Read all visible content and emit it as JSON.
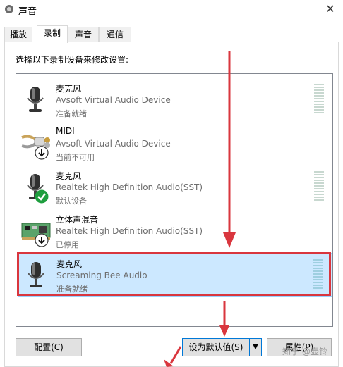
{
  "window": {
    "title": "声音",
    "close_glyph": "✕"
  },
  "tabs": [
    {
      "label": "播放",
      "active": false
    },
    {
      "label": "录制",
      "active": true
    },
    {
      "label": "声音",
      "active": false
    },
    {
      "label": "通信",
      "active": false
    }
  ],
  "instruction": "选择以下录制设备来修改设置:",
  "devices": [
    {
      "name": "麦克风",
      "driver": "Avsoft Virtual Audio Device",
      "status": "准备就绪",
      "icon": "microphone-icon",
      "badge": null
    },
    {
      "name": "MIDI",
      "driver": "Avsoft Virtual Audio Device",
      "status": "当前不可用",
      "icon": "midi-cable-icon",
      "badge": "down-arrow-badge"
    },
    {
      "name": "麦克风",
      "driver": "Realtek High Definition Audio(SST)",
      "status": "默认设备",
      "icon": "microphone-icon",
      "badge": "default-check-badge"
    },
    {
      "name": "立体声混音",
      "driver": "Realtek High Definition Audio(SST)",
      "status": "已停用",
      "icon": "sound-card-icon",
      "badge": "down-arrow-badge"
    },
    {
      "name": "麦克风",
      "driver": "Screaming Bee Audio",
      "status": "准备就绪",
      "icon": "microphone-icon",
      "badge": null,
      "selected": true
    }
  ],
  "buttons": {
    "configure": "配置(C)",
    "set_default": "设为默认值(S)",
    "properties": "属性(P)"
  },
  "watermark": "知乎 @壶铃",
  "colors": {
    "annotation_red": "#d9363e",
    "selection": "#cce8ff",
    "accent": "#0078d7"
  }
}
